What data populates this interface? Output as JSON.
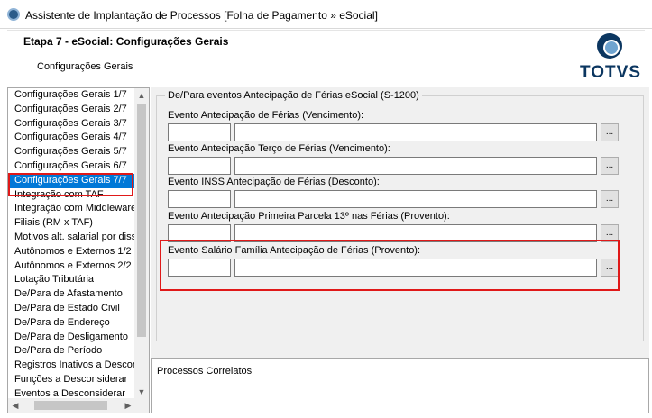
{
  "window": {
    "title": "Assistente de Implantação de Processos [Folha de Pagamento » eSocial]"
  },
  "header": {
    "step_title": "Etapa 7 - eSocial: Configurações Gerais",
    "step_subtitle": "Configurações Gerais",
    "logo_text": "TOTVS"
  },
  "sidebar": {
    "items": [
      {
        "label": "Configurações Gerais 1/7"
      },
      {
        "label": "Configurações Gerais 2/7"
      },
      {
        "label": "Configurações Gerais 3/7"
      },
      {
        "label": "Configurações Gerais 4/7"
      },
      {
        "label": "Configurações Gerais 5/7"
      },
      {
        "label": "Configurações Gerais 6/7"
      },
      {
        "label": "Configurações Gerais 7/7"
      },
      {
        "label": "Integração com TAF"
      },
      {
        "label": "Integração com Middleware"
      },
      {
        "label": "Filiais (RM x TAF)"
      },
      {
        "label": "Motivos alt. salarial por diss"
      },
      {
        "label": "Autônomos e Externos 1/2"
      },
      {
        "label": "Autônomos e Externos 2/2"
      },
      {
        "label": "Lotação Tributária"
      },
      {
        "label": "De/Para de Afastamento"
      },
      {
        "label": "De/Para de Estado Civil"
      },
      {
        "label": "De/Para de Endereço"
      },
      {
        "label": "De/Para de Desligamento"
      },
      {
        "label": "De/Para de Período"
      },
      {
        "label": "Registros Inativos a Descon"
      },
      {
        "label": "Funções a Desconsiderar"
      },
      {
        "label": "Eventos a Desconsiderar"
      }
    ],
    "selected_index": 6
  },
  "group": {
    "title": "De/Para eventos Antecipação de Férias eSocial (S-1200)",
    "fields": [
      {
        "label": "Evento Antecipação de Férias (Vencimento):",
        "code": "",
        "description": "",
        "button": "..."
      },
      {
        "label": "Evento Antecipação Terço de Férias (Vencimento):",
        "code": "",
        "description": "",
        "button": "..."
      },
      {
        "label": "Evento INSS Antecipação de Férias (Desconto):",
        "code": "",
        "description": "",
        "button": "..."
      },
      {
        "label": "Evento Antecipação Primeira Parcela 13º nas Férias (Provento):",
        "code": "",
        "description": "",
        "button": "..."
      },
      {
        "label": "Evento Salário Família Antecipação de Férias (Provento):",
        "code": "",
        "description": "",
        "button": "..."
      }
    ]
  },
  "related": {
    "label": "Processos Correlatos"
  },
  "colors": {
    "selection": "#0078d7",
    "highlight": "#e01919",
    "brand": "#0b3660"
  }
}
